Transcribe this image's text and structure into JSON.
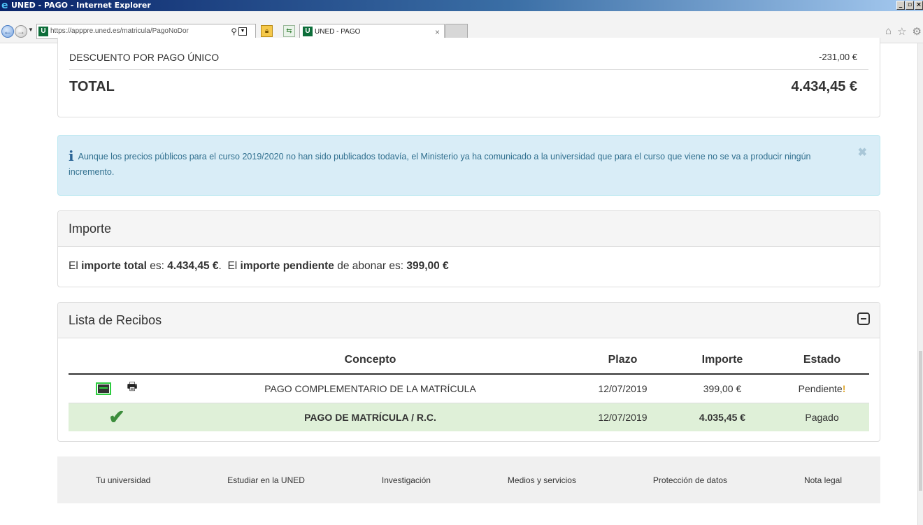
{
  "browser": {
    "window_title": "UNED - PAGO - Internet Explorer",
    "address_url": "https://apppre.uned.es/matricula/PagoNoDor",
    "tab_title": "UNED - PAGO",
    "favicon_letter": "U"
  },
  "totals": {
    "discount_label": "DESCUENTO POR PAGO ÚNICO",
    "discount_value": "-231,00 €",
    "total_label": "TOTAL",
    "total_value": "4.434,45 €"
  },
  "alert": {
    "text": "Aunque los precios públicos para el curso 2019/2020 no han sido publicados todavía, el Ministerio ya ha comunicado a la universidad que para el curso que viene no se va a producir ningún incremento."
  },
  "importe": {
    "heading": "Importe",
    "prefix": "El ",
    "total_label": "importe total",
    "es1": " es: ",
    "total_value": "4.434,45 €",
    "sep": ".  El ",
    "pending_label": "importe pendiente",
    "es2": " de abonar es: ",
    "pending_value": "399,00 €"
  },
  "recibos": {
    "heading": "Lista de Recibos",
    "columns": [
      "",
      "Concepto",
      "Plazo",
      "Importe",
      "Estado"
    ],
    "rows": [
      {
        "concepto": "PAGO COMPLEMENTARIO DE LA MATRÍCULA",
        "plazo": "12/07/2019",
        "importe": "399,00 €",
        "estado": "Pendiente"
      },
      {
        "concepto": "PAGO DE MATRÍCULA / R.C.",
        "plazo": "12/07/2019",
        "importe": "4.035,45 €",
        "estado": "Pagado"
      }
    ]
  },
  "footer": {
    "links": [
      "Tu universidad",
      "Estudiar en la UNED",
      "Investigación",
      "Medios y servicios",
      "Protección de datos",
      "Nota legal"
    ]
  },
  "colors": {
    "alert_bg": "#d9edf7",
    "alert_text": "#31708f",
    "paid_row_bg": "#dff0d8",
    "check_green": "#3c8d3c"
  }
}
